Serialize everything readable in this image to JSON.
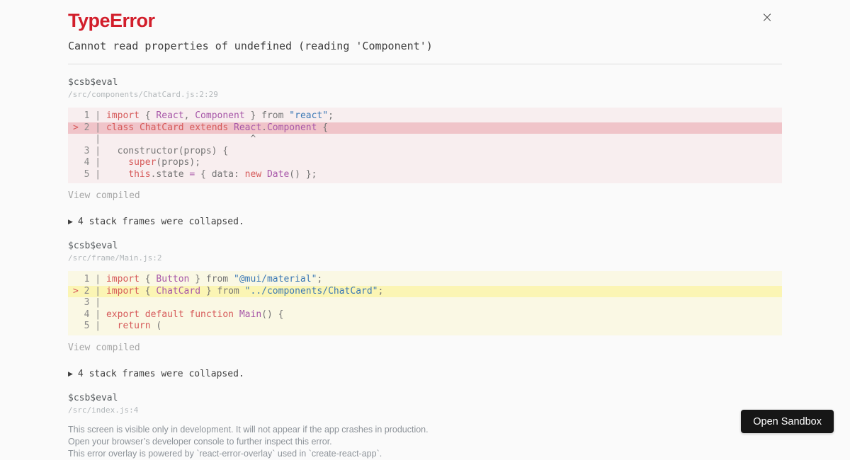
{
  "colors": {
    "accent_red": "#d21e2b",
    "error_block_bg": "rgba(206,17,38,0.05)",
    "error_line_bg": "rgba(206,17,38,0.19)",
    "warning_block_bg": "rgba(251,245,180,0.3)",
    "warning_line_bg": "#fbf5b4",
    "keyword": "#d65a5a",
    "identifier": "#a757a8",
    "string": "#3b78b5",
    "punctuation": "#757575",
    "button_bg": "#161616"
  },
  "header": {
    "title": "TypeError",
    "message": "Cannot read properties of undefined (reading 'Component')",
    "close_icon": "×"
  },
  "frames": [
    {
      "function_name": "$csb$eval",
      "location": "/src/components/ChatCard.js:2:29",
      "code": {
        "variant": "error",
        "lines": [
          {
            "num": "1",
            "marker": "",
            "highlight": false,
            "tokens": [
              [
                "kw",
                "import"
              ],
              [
                "p",
                " { "
              ],
              [
                "id",
                "React"
              ],
              [
                "p",
                ", "
              ],
              [
                "id",
                "Component"
              ],
              [
                "p",
                " } from "
              ],
              [
                "str",
                "\"react\""
              ],
              [
                "p",
                ";"
              ]
            ]
          },
          {
            "num": "2",
            "marker": ">",
            "highlight": true,
            "tokens": [
              [
                "kw",
                "class"
              ],
              [
                "p",
                " "
              ],
              [
                "kw",
                "ChatCard"
              ],
              [
                "p",
                " "
              ],
              [
                "kw",
                "extends"
              ],
              [
                "p",
                " "
              ],
              [
                "id",
                "React"
              ],
              [
                "p",
                "."
              ],
              [
                "id",
                "Component"
              ],
              [
                "p",
                " {"
              ]
            ]
          },
          {
            "num": "",
            "marker": "",
            "highlight": false,
            "tokens": [
              [
                "p",
                "                          ^"
              ]
            ]
          },
          {
            "num": "3",
            "marker": "",
            "highlight": false,
            "tokens": [
              [
                "p",
                "  constructor(props) {"
              ]
            ]
          },
          {
            "num": "4",
            "marker": "",
            "highlight": false,
            "tokens": [
              [
                "p",
                "    "
              ],
              [
                "kw",
                "super"
              ],
              [
                "p",
                "(props);"
              ]
            ]
          },
          {
            "num": "5",
            "marker": "",
            "highlight": false,
            "tokens": [
              [
                "p",
                "    "
              ],
              [
                "kw",
                "this"
              ],
              [
                "p",
                ".state "
              ],
              [
                "op",
                "="
              ],
              [
                "p",
                " { data: "
              ],
              [
                "kw",
                "new"
              ],
              [
                "p",
                " "
              ],
              [
                "id",
                "Date"
              ],
              [
                "p",
                "() };"
              ]
            ]
          }
        ]
      },
      "view_compiled_label": "View compiled",
      "collapsed_toggle": {
        "icon": "▶",
        "label": "4 stack frames were collapsed."
      }
    },
    {
      "function_name": "$csb$eval",
      "location": "/src/frame/Main.js:2",
      "code": {
        "variant": "warning",
        "lines": [
          {
            "num": "1",
            "marker": "",
            "highlight": false,
            "tokens": [
              [
                "kw",
                "import"
              ],
              [
                "p",
                " { "
              ],
              [
                "id",
                "Button"
              ],
              [
                "p",
                " } from "
              ],
              [
                "str",
                "\"@mui/material\""
              ],
              [
                "p",
                ";"
              ]
            ]
          },
          {
            "num": "2",
            "marker": ">",
            "highlight": true,
            "tokens": [
              [
                "kw",
                "import"
              ],
              [
                "p",
                " { "
              ],
              [
                "id",
                "ChatCard"
              ],
              [
                "p",
                " } from "
              ],
              [
                "str",
                "\"../components/ChatCard\""
              ],
              [
                "p",
                ";"
              ]
            ]
          },
          {
            "num": "3",
            "marker": "",
            "highlight": false,
            "tokens": []
          },
          {
            "num": "4",
            "marker": "",
            "highlight": false,
            "tokens": [
              [
                "kw",
                "export"
              ],
              [
                "p",
                " "
              ],
              [
                "kw",
                "default"
              ],
              [
                "p",
                " "
              ],
              [
                "kw",
                "function"
              ],
              [
                "p",
                " "
              ],
              [
                "id",
                "Main"
              ],
              [
                "p",
                "() {"
              ]
            ]
          },
          {
            "num": "5",
            "marker": "",
            "highlight": false,
            "tokens": [
              [
                "p",
                "  "
              ],
              [
                "kw",
                "return"
              ],
              [
                "p",
                " ("
              ]
            ]
          }
        ]
      },
      "view_compiled_label": "View compiled",
      "collapsed_toggle": {
        "icon": "▶",
        "label": "4 stack frames were collapsed."
      }
    },
    {
      "function_name": "$csb$eval",
      "location": "/src/index.js:4"
    }
  ],
  "footer": {
    "line1": "This screen is visible only in development. It will not appear if the app crashes in production.",
    "line2": "Open your browser’s developer console to further inspect this error.",
    "line3": "This error overlay is powered by `react-error-overlay` used in `create-react-app`."
  },
  "open_sandbox_label": "Open Sandbox"
}
